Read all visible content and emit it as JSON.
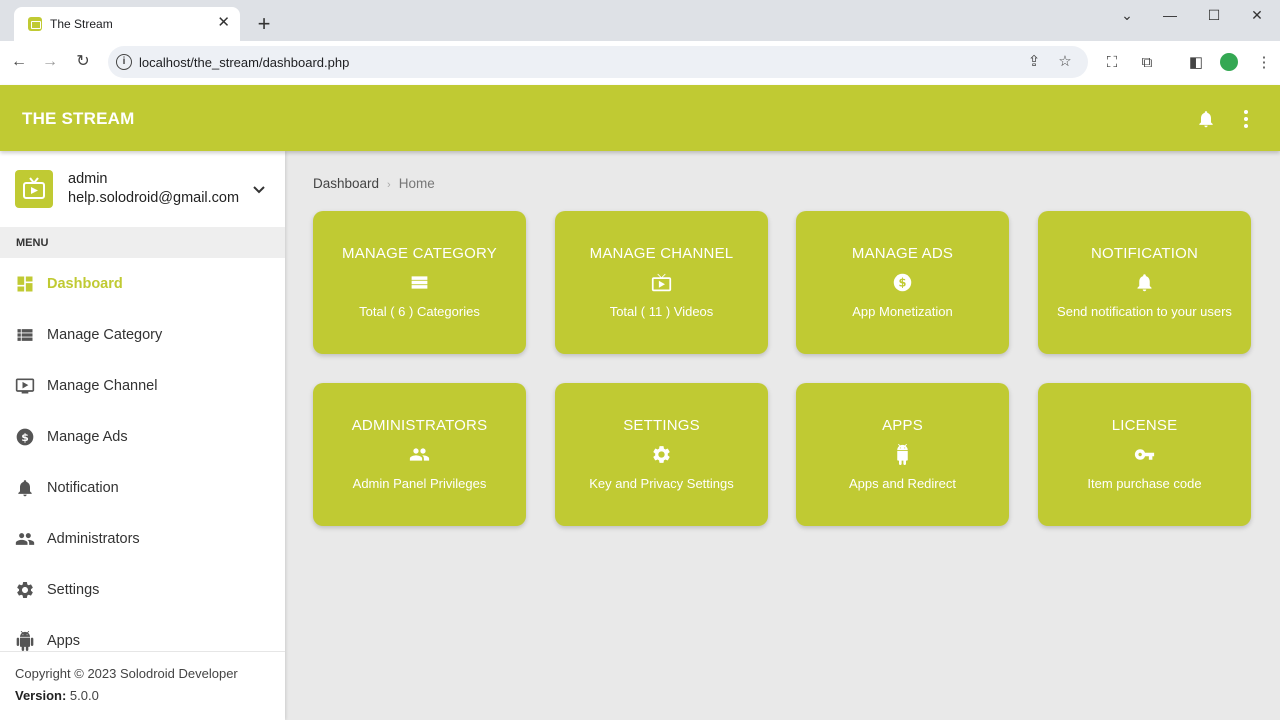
{
  "browser": {
    "tab_title": "The Stream",
    "url": "localhost/the_stream/dashboard.php"
  },
  "app": {
    "title": "THE STREAM"
  },
  "user": {
    "name": "admin",
    "email": "help.solodroid@gmail.com"
  },
  "sidebar": {
    "menu_header": "MENU",
    "items": [
      {
        "label": "Dashboard",
        "icon": "dashboard-icon"
      },
      {
        "label": "Manage Category",
        "icon": "list-icon"
      },
      {
        "label": "Manage Channel",
        "icon": "tv-icon"
      },
      {
        "label": "Manage Ads",
        "icon": "dollar-icon"
      },
      {
        "label": "Notification",
        "icon": "bell-icon"
      },
      {
        "label": "Administrators",
        "icon": "people-icon"
      },
      {
        "label": "Settings",
        "icon": "gear-icon"
      },
      {
        "label": "Apps",
        "icon": "android-icon"
      }
    ],
    "copyright": "Copyright © 2023 Solodroid Developer",
    "version_label": "Version:",
    "version_value": "5.0.0"
  },
  "breadcrumb": {
    "parent": "Dashboard",
    "current": "Home"
  },
  "cards": [
    {
      "title": "MANAGE CATEGORY",
      "subtitle": "Total ( 6 ) Categories",
      "icon": "list-icon"
    },
    {
      "title": "MANAGE CHANNEL",
      "subtitle": "Total ( 11 ) Videos",
      "icon": "tv-icon"
    },
    {
      "title": "MANAGE ADS",
      "subtitle": "App Monetization",
      "icon": "dollar-icon"
    },
    {
      "title": "NOTIFICATION",
      "subtitle": "Send notification to your users",
      "icon": "bell-icon"
    },
    {
      "title": "ADMINISTRATORS",
      "subtitle": "Admin Panel Privileges",
      "icon": "people-icon"
    },
    {
      "title": "SETTINGS",
      "subtitle": "Key and Privacy Settings",
      "icon": "gear-icon"
    },
    {
      "title": "APPS",
      "subtitle": "Apps and Redirect",
      "icon": "android-icon"
    },
    {
      "title": "LICENSE",
      "subtitle": "Item purchase code",
      "icon": "key-icon"
    }
  ],
  "colors": {
    "accent": "#c0ca33",
    "content_bg": "#e9e9e9"
  }
}
